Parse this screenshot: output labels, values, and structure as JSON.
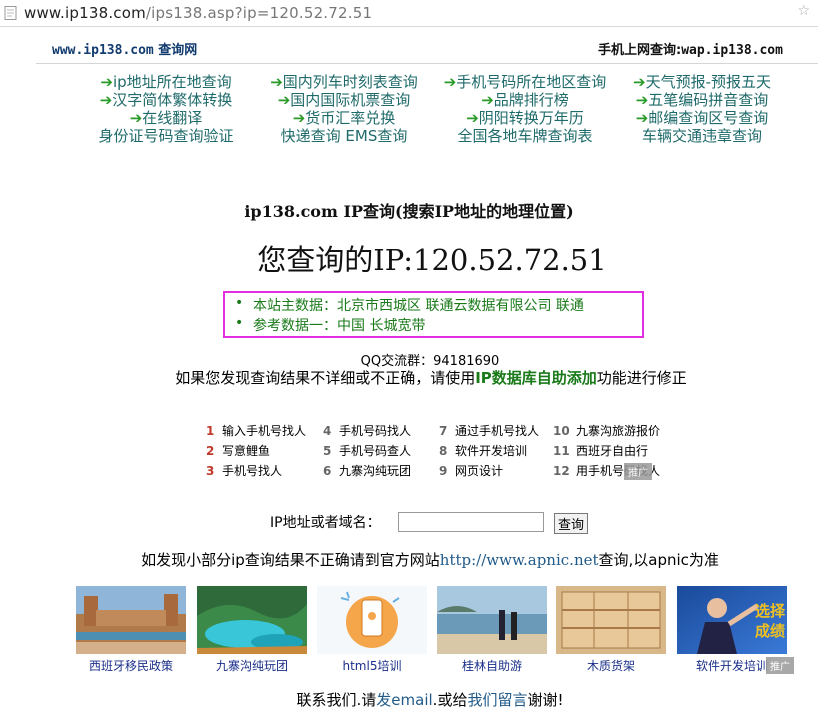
{
  "browser": {
    "url_prefix": "www.ip138.com",
    "url_path": "/ips138.asp?ip=120.52.72.51"
  },
  "header": {
    "left_domain": "www.ip138.com",
    "left_label": "查询网",
    "right_label": "手机上网查询:",
    "right_domain": "wap.ip138.com"
  },
  "nav": {
    "col1": [
      "ip地址所在地查询",
      "汉字简体繁体转换",
      "在线翻译",
      "身份证号码查询验证"
    ],
    "col2": [
      "国内列车时刻表查询",
      "国内国际机票查询",
      "货币汇率兑换",
      "快递查询 EMS查询"
    ],
    "col3": [
      "手机号码所在地区查询",
      "品牌排行榜",
      "阴阳转换万年历",
      "全国各地车牌查询表"
    ],
    "col4": [
      "天气预报-预报五天",
      "五笔编码拼音查询",
      "邮编查询区号查询",
      "车辆交通违章查询"
    ],
    "arrow": "➔"
  },
  "main": {
    "title": "ip138.com IP查询(搜索IP地址的地理位置)",
    "ip_label": "您查询的IP:",
    "ip_value": "120.52.72.51",
    "result_primary": "本站主数据：北京市西城区 联通云数据有限公司 联通",
    "result_secondary": "参考数据一：中国 长城宽带",
    "qq_group": "QQ交流群：94181690",
    "fix_before": "如果您发现查询结果不详细或不正确，请使用",
    "fix_link": "IP数据库自助添加",
    "fix_after": "功能进行修正"
  },
  "ads": {
    "col1": [
      {
        "n": "1",
        "t": "输入手机号找人"
      },
      {
        "n": "2",
        "t": "写意鲤鱼"
      },
      {
        "n": "3",
        "t": "手机号找人"
      }
    ],
    "col2": [
      {
        "n": "4",
        "t": "手机号码找人"
      },
      {
        "n": "5",
        "t": "手机号码查人"
      },
      {
        "n": "6",
        "t": "九寨沟纯玩团"
      }
    ],
    "col3": [
      {
        "n": "7",
        "t": "通过手机号找人"
      },
      {
        "n": "8",
        "t": "软件开发培训"
      },
      {
        "n": "9",
        "t": "网页设计"
      }
    ],
    "col4": [
      {
        "n": "10",
        "t": "九寨沟旅游报价"
      },
      {
        "n": "11",
        "t": "西班牙自由行"
      },
      {
        "n": "12",
        "t": "用手机号码找人"
      }
    ],
    "ad_tag": "推广"
  },
  "query": {
    "label": "IP地址或者域名：",
    "input_value": "",
    "button": "查询"
  },
  "apnic": {
    "before": "如发现小部分ip查询结果不正确请到官方网站",
    "link": "http://www.apnic.net",
    "after": "查询,以apnic为准"
  },
  "gallery": [
    {
      "caption": "西班牙移民政策",
      "icon": "plaza-photo"
    },
    {
      "caption": "九寨沟纯玩团",
      "icon": "lake-photo"
    },
    {
      "caption": "html5培训",
      "icon": "phone-icon"
    },
    {
      "caption": "桂林自助游",
      "icon": "beach-photo"
    },
    {
      "caption": "木质货架",
      "icon": "shelf-photo"
    },
    {
      "caption": "软件开发培训",
      "icon": "banner-photo"
    }
  ],
  "gallery_ad_tag": "推广",
  "banner_text": "选择成绩",
  "contact": {
    "before": "联系我们.请",
    "email": "发email",
    "mid": ".或给",
    "msg": "我们留言",
    "after": "谢谢!"
  }
}
